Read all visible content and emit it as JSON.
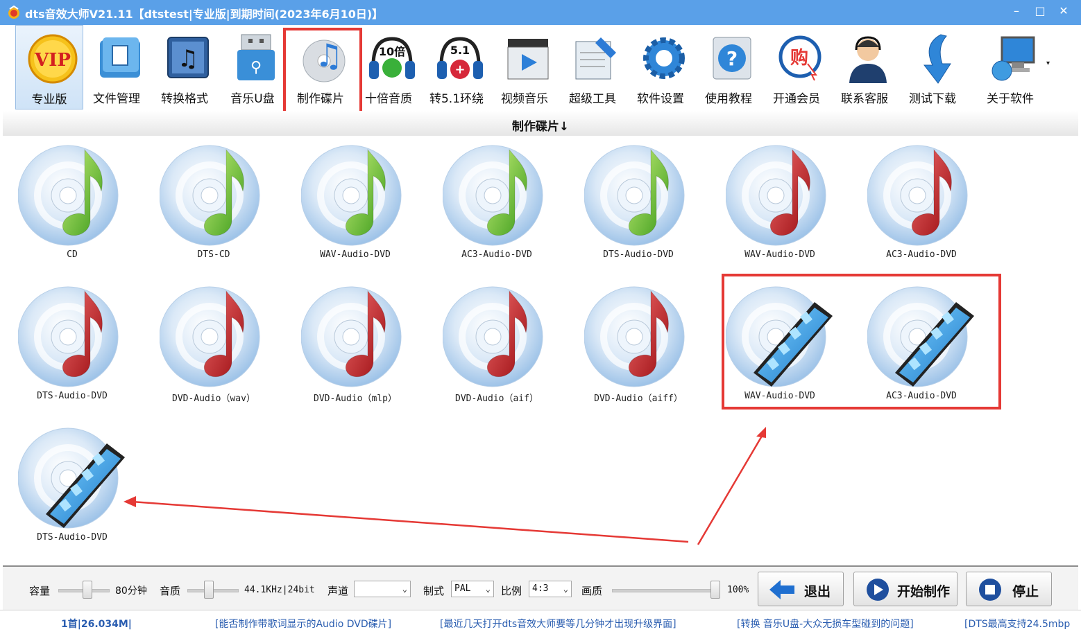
{
  "window": {
    "title": "dts音效大师V21.11【dtstest|专业版|到期时间(2023年6月10日)】",
    "controls": {
      "minimize": "–",
      "maximize": "□",
      "close": "✕"
    }
  },
  "toolbar": {
    "items": [
      {
        "label": "专业版",
        "icon": "vip-badge-icon",
        "selected": true
      },
      {
        "label": "文件管理",
        "icon": "file-manage-icon"
      },
      {
        "label": "转换格式",
        "icon": "convert-format-icon"
      },
      {
        "label": "音乐U盘",
        "icon": "usb-drive-icon"
      },
      {
        "label": "制作碟片",
        "icon": "make-disc-icon",
        "highlighted": true
      },
      {
        "label": "十倍音质",
        "icon": "ten-times-quality-icon",
        "badge": "10倍"
      },
      {
        "label": "转5.1环绕",
        "icon": "surround-51-icon",
        "badge": "5.1"
      },
      {
        "label": "视频音乐",
        "icon": "video-music-icon"
      },
      {
        "label": "超级工具",
        "icon": "super-tools-icon"
      },
      {
        "label": "软件设置",
        "icon": "settings-gear-icon"
      },
      {
        "label": "使用教程",
        "icon": "help-tutorial-icon"
      },
      {
        "label": "开通会员",
        "icon": "membership-cart-icon",
        "badge": "购"
      },
      {
        "label": "联系客服",
        "icon": "customer-service-icon"
      },
      {
        "label": "测试下载",
        "icon": "download-arrow-icon"
      },
      {
        "label": "关于软件",
        "icon": "about-computer-icon"
      }
    ],
    "more": "▾"
  },
  "section": {
    "title": "制作碟片↓"
  },
  "discs": [
    {
      "label": "CD",
      "kind": "green-note"
    },
    {
      "label": "DTS-CD",
      "kind": "green-note"
    },
    {
      "label": "WAV-Audio-DVD",
      "kind": "green-note"
    },
    {
      "label": "AC3-Audio-DVD",
      "kind": "green-note"
    },
    {
      "label": "DTS-Audio-DVD",
      "kind": "green-note"
    },
    {
      "label": "WAV-Audio-DVD",
      "kind": "red-note"
    },
    {
      "label": "AC3-Audio-DVD",
      "kind": "red-note"
    },
    {
      "label": "DTS-Audio-DVD",
      "kind": "red-note"
    },
    {
      "label": "DVD-Audio（wav）",
      "kind": "red-note"
    },
    {
      "label": "DVD-Audio（mlp）",
      "kind": "red-note"
    },
    {
      "label": "DVD-Audio（aif）",
      "kind": "red-note"
    },
    {
      "label": "DVD-Audio（aiff）",
      "kind": "red-note"
    },
    {
      "label": "WAV-Audio-DVD",
      "kind": "film"
    },
    {
      "label": "AC3-Audio-DVD",
      "kind": "film"
    },
    {
      "label": "DTS-Audio-DVD",
      "kind": "film"
    }
  ],
  "controls": {
    "capacity_label": "容量",
    "capacity_value": "80分钟",
    "quality_label": "音质",
    "quality_value": "44.1KHz|24bit",
    "channel_label": "声道",
    "channel_value": "",
    "format_label": "制式",
    "format_value": "PAL",
    "ratio_label": "比例",
    "ratio_value": "4:3",
    "picture_label": "画质",
    "picture_value": "100%",
    "exit_button": "退出",
    "start_button": "开始制作",
    "stop_button": "停止"
  },
  "status": {
    "count": "1首|26.034M|",
    "links": [
      "[能否制作带歌词显示的Audio DVD碟片]",
      "[最近几天打开dts音效大师要等几分钟才出现升级界面]",
      "[转换 音乐U盘-大众无损车型碰到的问题]",
      "[DTS最高支持24.5mbp"
    ]
  },
  "colors": {
    "titlebar": "#5aa0e8",
    "highlight": "#e53935",
    "status_text": "#2a5db0"
  }
}
